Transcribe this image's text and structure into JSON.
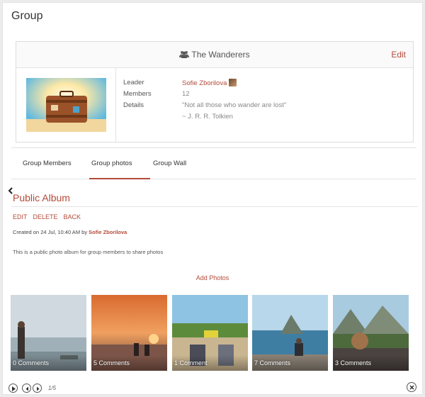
{
  "page": {
    "title": "Group"
  },
  "group": {
    "icon": "group-icon",
    "name": "The Wanderers",
    "edit_label": "Edit",
    "details": {
      "leader_label": "Leader",
      "leader_value": "Sofie Zborilova",
      "members_label": "Members",
      "members_value": "12",
      "details_label": "Details",
      "details_quote": "\"Not all those who wander are lost\"",
      "details_author": "~ J. R. R. Tolkien"
    }
  },
  "tabs": [
    {
      "label": "Group Members"
    },
    {
      "label": "Group photos"
    },
    {
      "label": "Group Wall"
    }
  ],
  "active_tab": "Group photos",
  "album": {
    "title": "Public Album",
    "actions": {
      "edit": "EDIT",
      "delete": "DELETE",
      "back": "BACK"
    },
    "created_prefix": "Created on 24 Jul, 10:40 AM by",
    "created_by": "Sofie Zborilova",
    "description": "This is a public photo album for group members to share photos",
    "add_photos": "Add Photos"
  },
  "photos": [
    {
      "caption": "0 Comments"
    },
    {
      "caption": "5 Comments"
    },
    {
      "caption": "1 Comment"
    },
    {
      "caption": "7 Comments"
    },
    {
      "caption": "3 Comments"
    }
  ],
  "pager": {
    "count": "1/5"
  },
  "colors": {
    "accent": "#b44a3a",
    "text": "#333333",
    "border": "#dddddd"
  }
}
